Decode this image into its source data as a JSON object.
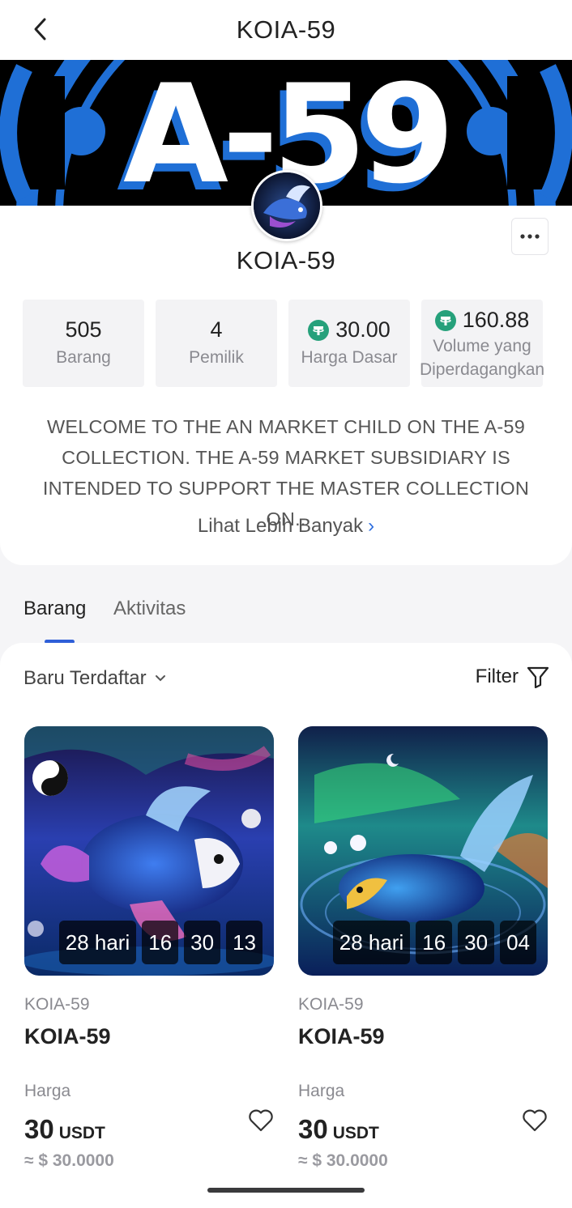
{
  "header": {
    "title": "KOIA-59",
    "back_icon": "chevron-left-icon"
  },
  "banner": {
    "text": "A-59",
    "colors": {
      "accent": "#1f7ae0",
      "background": "#000000"
    }
  },
  "profile": {
    "name": "KOIA-59",
    "more_icon": "more-horizontal-icon",
    "stats": [
      {
        "value": "505",
        "label": "Barang"
      },
      {
        "value": "4",
        "label": "Pemilik"
      },
      {
        "value": "30.00",
        "label": "Harga Dasar",
        "icon": "tether-icon"
      },
      {
        "value": "160.88",
        "label": "Volume yang Diperdagangkan",
        "icon": "tether-icon"
      }
    ],
    "description": "WELCOME TO THE AN MARKET CHILD ON THE A-59 COLLECTION. THE A-59 MARKET SUBSIDIARY IS INTENDED TO SUPPORT THE MASTER COLLECTION ON..",
    "see_more": "Lihat Lebih Banyak"
  },
  "tabs": [
    {
      "label": "Barang",
      "active": true
    },
    {
      "label": "Aktivitas",
      "active": false
    }
  ],
  "toolbar": {
    "sort_label": "Baru Terdaftar",
    "filter_label": "Filter"
  },
  "items": [
    {
      "collection": "KOIA-59",
      "name": "KOIA-59",
      "countdown": [
        "28 hari",
        "16",
        "30",
        "13"
      ],
      "price_label": "Harga",
      "price": "30",
      "unit": "USDT",
      "fiat": "≈ $ 30.0000"
    },
    {
      "collection": "KOIA-59",
      "name": "KOIA-59",
      "countdown": [
        "28 hari",
        "16",
        "30",
        "04"
      ],
      "price_label": "Harga",
      "price": "30",
      "unit": "USDT",
      "fiat": "≈ $ 30.0000"
    }
  ],
  "colors": {
    "tab_indicator": "#2f5fd8",
    "tether": "#26a17b",
    "link": "#2f6fe0"
  }
}
